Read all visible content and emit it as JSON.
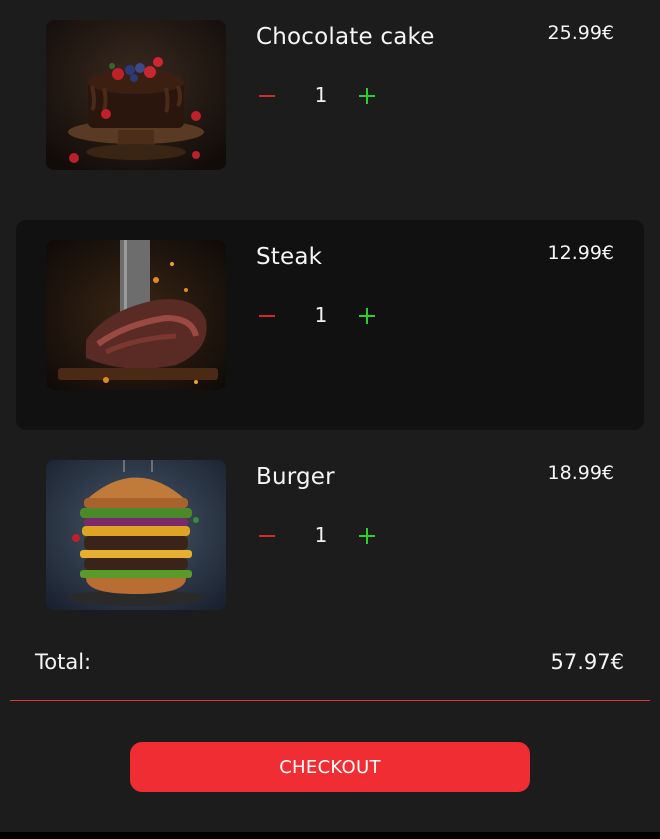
{
  "cart": {
    "items": [
      {
        "name": "Chocolate cake",
        "price": "25.99€",
        "quantity": "1",
        "image": "chocolate-cake-image"
      },
      {
        "name": "Steak",
        "price": "12.99€",
        "quantity": "1",
        "image": "steak-image"
      },
      {
        "name": "Burger",
        "price": "18.99€",
        "quantity": "1",
        "image": "burger-image"
      }
    ]
  },
  "summary": {
    "total_label": "Total:",
    "total_value": "57.97€"
  },
  "actions": {
    "checkout_label": "CHECKOUT"
  },
  "colors": {
    "background": "#1c1c1c",
    "highlight_row": "#111111",
    "accent_red": "#f12d34",
    "minus_red": "#d02a2a",
    "plus_green": "#2ecc2e"
  }
}
